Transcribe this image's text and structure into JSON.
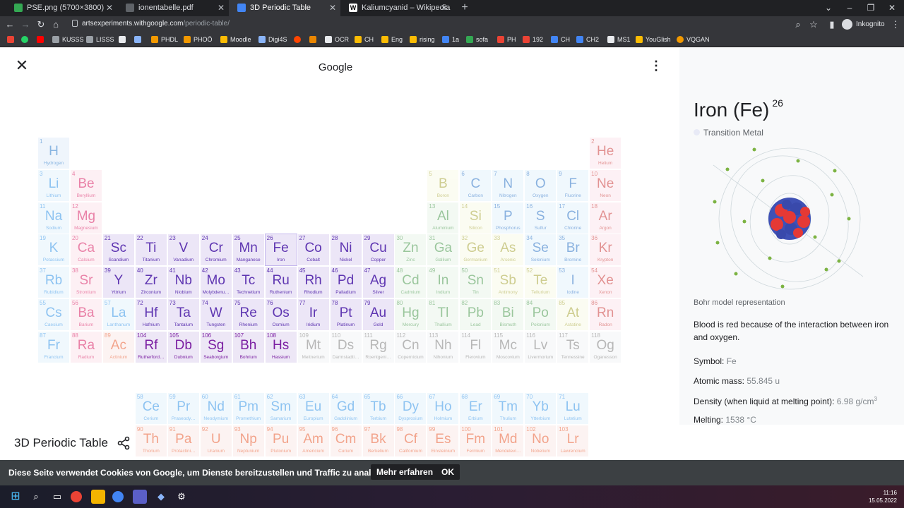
{
  "browser": {
    "tabs": [
      {
        "title": "PSE.png (5700×3800)",
        "icon": "image-icon",
        "color": "#34a853"
      },
      {
        "title": "ionentabelle.pdf",
        "icon": "pdf-icon",
        "color": "#5f6368"
      },
      {
        "title": "3D Periodic Table",
        "icon": "ae-icon",
        "color": "#4285f4"
      },
      {
        "title": "Kaliumcyanid – Wikipedia",
        "icon": "wikipedia-icon",
        "color": "#ffffff"
      }
    ],
    "new_tab": "+",
    "url_domain": "artsexperiments.withgoogle.com",
    "url_path": "/periodic-table/",
    "profile": "Inkognito",
    "bookmarks": [
      "",
      "",
      "",
      "KUSSS",
      "LISSS",
      "",
      "",
      "PHDL",
      "PHOÖ",
      "Moodle",
      "Digi4S",
      "",
      "",
      "OCR",
      "CH",
      "Eng",
      "rising",
      "1a",
      "sofa",
      "PH",
      "192",
      "CH",
      "CH2",
      "MS1",
      "YouGlish",
      "VQGAN"
    ]
  },
  "header": {
    "title": "Google",
    "close_icon": "close-icon",
    "menu_icon": "more-vert-icon"
  },
  "element_panel": {
    "name": "Iron (Fe)",
    "number": "26",
    "category": "Transition Metal",
    "bohr_caption": "Bohr model representation",
    "fact": "Blood is red because of the interaction between iron and oxygen.",
    "properties": [
      {
        "label": "Symbol:",
        "value": "Fe",
        "sup": ""
      },
      {
        "label": "Atomic mass:",
        "value": "55.845 u",
        "sup": ""
      },
      {
        "label": "Density (when liquid at melting point):",
        "value": "6.98 g/cm",
        "sup": "3"
      },
      {
        "label": "Melting:",
        "value": "1538 °C",
        "sup": ""
      }
    ]
  },
  "footer": {
    "title": "3D Periodic Table",
    "share_icon": "share-icon"
  },
  "cookie": {
    "text": "Diese Seite verwendet Cookies von Google, um Dienste bereitzustellen und Traffic zu analysieren.",
    "more": "Mehr erfahren",
    "ok": "OK"
  },
  "taskbar": {
    "time": "11:16",
    "date": "15.05.2022"
  },
  "colors": {
    "H": "#2979c9",
    "M": "#d81b60",
    "E": "#7b1fa2",
    "T": "#5e35b1",
    "L": "#1e88e5",
    "A": "#e64a19",
    "P": "#388e3c",
    "Q": "#9e9d24",
    "N": "#1565c0",
    "G": "#c62828",
    "Z": "#616161"
  },
  "elements": [
    [
      "1",
      "H",
      "Hydrogen",
      "H",
      1,
      1
    ],
    [
      "2",
      "He",
      "Helium",
      "G",
      1,
      18
    ],
    [
      "3",
      "Li",
      "Lithium",
      "L",
      2,
      1
    ],
    [
      "4",
      "Be",
      "Beryllium",
      "M",
      2,
      2
    ],
    [
      "5",
      "B",
      "Boron",
      "Q",
      2,
      13
    ],
    [
      "6",
      "C",
      "Carbon",
      "N",
      2,
      14
    ],
    [
      "7",
      "N",
      "Nitrogen",
      "N",
      2,
      15
    ],
    [
      "8",
      "O",
      "Oxygen",
      "N",
      2,
      16
    ],
    [
      "9",
      "F",
      "Fluorine",
      "N",
      2,
      17
    ],
    [
      "10",
      "Ne",
      "Neon",
      "G",
      2,
      18
    ],
    [
      "11",
      "Na",
      "Sodium",
      "L",
      3,
      1
    ],
    [
      "12",
      "Mg",
      "Magnesium",
      "M",
      3,
      2
    ],
    [
      "13",
      "Al",
      "Aluminium",
      "P",
      3,
      13
    ],
    [
      "14",
      "Si",
      "Silicon",
      "Q",
      3,
      14
    ],
    [
      "15",
      "P",
      "Phosphorus",
      "N",
      3,
      15
    ],
    [
      "16",
      "S",
      "Sulfur",
      "N",
      3,
      16
    ],
    [
      "17",
      "Cl",
      "Chlorine",
      "N",
      3,
      17
    ],
    [
      "18",
      "Ar",
      "Argon",
      "G",
      3,
      18
    ],
    [
      "19",
      "K",
      "Potassium",
      "L",
      4,
      1
    ],
    [
      "20",
      "Ca",
      "Calcium",
      "M",
      4,
      2
    ],
    [
      "21",
      "Sc",
      "Scandium",
      "T",
      4,
      3
    ],
    [
      "22",
      "Ti",
      "Titanium",
      "T",
      4,
      4
    ],
    [
      "23",
      "V",
      "Vanadium",
      "T",
      4,
      5
    ],
    [
      "24",
      "Cr",
      "Chromium",
      "T",
      4,
      6
    ],
    [
      "25",
      "Mn",
      "Manganese",
      "T",
      4,
      7
    ],
    [
      "26",
      "Fe",
      "Iron",
      "T",
      4,
      8
    ],
    [
      "27",
      "Co",
      "Cobalt",
      "T",
      4,
      9
    ],
    [
      "28",
      "Ni",
      "Nickel",
      "T",
      4,
      10
    ],
    [
      "29",
      "Cu",
      "Copper",
      "T",
      4,
      11
    ],
    [
      "30",
      "Zn",
      "Zinc",
      "P",
      4,
      12
    ],
    [
      "31",
      "Ga",
      "Gallium",
      "P",
      4,
      13
    ],
    [
      "32",
      "Ge",
      "Germanium",
      "Q",
      4,
      14
    ],
    [
      "33",
      "As",
      "Arsenic",
      "Q",
      4,
      15
    ],
    [
      "34",
      "Se",
      "Selenium",
      "N",
      4,
      16
    ],
    [
      "35",
      "Br",
      "Bromine",
      "N",
      4,
      17
    ],
    [
      "36",
      "Kr",
      "Krypton",
      "G",
      4,
      18
    ],
    [
      "37",
      "Rb",
      "Rubidium",
      "L",
      5,
      1
    ],
    [
      "38",
      "Sr",
      "Strontium",
      "M",
      5,
      2
    ],
    [
      "39",
      "Y",
      "Yttrium",
      "T",
      5,
      3
    ],
    [
      "40",
      "Zr",
      "Zirconium",
      "T",
      5,
      4
    ],
    [
      "41",
      "Nb",
      "Niobium",
      "T",
      5,
      5
    ],
    [
      "42",
      "Mo",
      "Molybdenu…",
      "T",
      5,
      6
    ],
    [
      "43",
      "Tc",
      "Technetium",
      "T",
      5,
      7
    ],
    [
      "44",
      "Ru",
      "Ruthenium",
      "T",
      5,
      8
    ],
    [
      "45",
      "Rh",
      "Rhodium",
      "T",
      5,
      9
    ],
    [
      "46",
      "Pd",
      "Palladium",
      "T",
      5,
      10
    ],
    [
      "47",
      "Ag",
      "Silver",
      "T",
      5,
      11
    ],
    [
      "48",
      "Cd",
      "Cadmium",
      "P",
      5,
      12
    ],
    [
      "49",
      "In",
      "Indium",
      "P",
      5,
      13
    ],
    [
      "50",
      "Sn",
      "Tin",
      "P",
      5,
      14
    ],
    [
      "51",
      "Sb",
      "Antimony",
      "Q",
      5,
      15
    ],
    [
      "52",
      "Te",
      "Tellurium",
      "Q",
      5,
      16
    ],
    [
      "53",
      "I",
      "Iodine",
      "N",
      5,
      17
    ],
    [
      "54",
      "Xe",
      "Xenon",
      "G",
      5,
      18
    ],
    [
      "55",
      "Cs",
      "Caesium",
      "L",
      6,
      1
    ],
    [
      "56",
      "Ba",
      "Barium",
      "M",
      6,
      2
    ],
    [
      "57",
      "La",
      "Lanthanum",
      "L",
      6,
      3
    ],
    [
      "72",
      "Hf",
      "Hafnium",
      "T",
      6,
      4
    ],
    [
      "73",
      "Ta",
      "Tantalum",
      "T",
      6,
      5
    ],
    [
      "74",
      "W",
      "Tungsten",
      "T",
      6,
      6
    ],
    [
      "75",
      "Re",
      "Rhenium",
      "T",
      6,
      7
    ],
    [
      "76",
      "Os",
      "Osmium",
      "T",
      6,
      8
    ],
    [
      "77",
      "Ir",
      "Iridium",
      "T",
      6,
      9
    ],
    [
      "78",
      "Pt",
      "Platinum",
      "T",
      6,
      10
    ],
    [
      "79",
      "Au",
      "Gold",
      "T",
      6,
      11
    ],
    [
      "80",
      "Hg",
      "Mercury",
      "P",
      6,
      12
    ],
    [
      "81",
      "Tl",
      "Thallium",
      "P",
      6,
      13
    ],
    [
      "82",
      "Pb",
      "Lead",
      "P",
      6,
      14
    ],
    [
      "83",
      "Bi",
      "Bismuth",
      "P",
      6,
      15
    ],
    [
      "84",
      "Po",
      "Polonium",
      "P",
      6,
      16
    ],
    [
      "85",
      "At",
      "Astatine",
      "Q",
      6,
      17
    ],
    [
      "86",
      "Rn",
      "Radon",
      "G",
      6,
      18
    ],
    [
      "87",
      "Fr",
      "Francium",
      "L",
      7,
      1
    ],
    [
      "88",
      "Ra",
      "Radium",
      "M",
      7,
      2
    ],
    [
      "89",
      "Ac",
      "Actinium",
      "A",
      7,
      3
    ],
    [
      "104",
      "Rf",
      "Rutherford…",
      "E",
      7,
      4
    ],
    [
      "105",
      "Db",
      "Dubnium",
      "E",
      7,
      5
    ],
    [
      "106",
      "Sg",
      "Seaborgium",
      "E",
      7,
      6
    ],
    [
      "107",
      "Bh",
      "Bohrium",
      "E",
      7,
      7
    ],
    [
      "108",
      "Hs",
      "Hassium",
      "E",
      7,
      8
    ],
    [
      "109",
      "Mt",
      "Meitnerium",
      "Z",
      7,
      9
    ],
    [
      "110",
      "Ds",
      "Darmstadti…",
      "Z",
      7,
      10
    ],
    [
      "111",
      "Rg",
      "Roentgeni…",
      "Z",
      7,
      11
    ],
    [
      "112",
      "Cn",
      "Copernicium",
      "Z",
      7,
      12
    ],
    [
      "113",
      "Nh",
      "Nihonium",
      "Z",
      7,
      13
    ],
    [
      "114",
      "Fl",
      "Flerovium",
      "Z",
      7,
      14
    ],
    [
      "115",
      "Mc",
      "Moscovium",
      "Z",
      7,
      15
    ],
    [
      "116",
      "Lv",
      "Livermorium",
      "Z",
      7,
      16
    ],
    [
      "117",
      "Ts",
      "Tennessine",
      "Z",
      7,
      17
    ],
    [
      "118",
      "Og",
      "Oganesson",
      "Z",
      7,
      18
    ],
    [
      "58",
      "Ce",
      "Cerium",
      "L",
      9,
      4
    ],
    [
      "59",
      "Pr",
      "Praseody…",
      "L",
      9,
      5
    ],
    [
      "60",
      "Nd",
      "Neodymium",
      "L",
      9,
      6
    ],
    [
      "61",
      "Pm",
      "Promethium",
      "L",
      9,
      7
    ],
    [
      "62",
      "Sm",
      "Samarium",
      "L",
      9,
      8
    ],
    [
      "63",
      "Eu",
      "Europium",
      "L",
      9,
      9
    ],
    [
      "64",
      "Gd",
      "Gadolinium",
      "L",
      9,
      10
    ],
    [
      "65",
      "Tb",
      "Terbium",
      "L",
      9,
      11
    ],
    [
      "66",
      "Dy",
      "Dysprosium",
      "L",
      9,
      12
    ],
    [
      "67",
      "Ho",
      "Holmium",
      "L",
      9,
      13
    ],
    [
      "68",
      "Er",
      "Erbium",
      "L",
      9,
      14
    ],
    [
      "69",
      "Tm",
      "Thulium",
      "L",
      9,
      15
    ],
    [
      "70",
      "Yb",
      "Ytterbium",
      "L",
      9,
      16
    ],
    [
      "71",
      "Lu",
      "Lutetium",
      "L",
      9,
      17
    ],
    [
      "90",
      "Th",
      "Thorium",
      "A",
      10,
      4
    ],
    [
      "91",
      "Pa",
      "Protactini…",
      "A",
      10,
      5
    ],
    [
      "92",
      "U",
      "Uranium",
      "A",
      10,
      6
    ],
    [
      "93",
      "Np",
      "Neptunium",
      "A",
      10,
      7
    ],
    [
      "94",
      "Pu",
      "Plutonium",
      "A",
      10,
      8
    ],
    [
      "95",
      "Am",
      "Americium",
      "A",
      10,
      9
    ],
    [
      "96",
      "Cm",
      "Curium",
      "A",
      10,
      10
    ],
    [
      "97",
      "Bk",
      "Berkelium",
      "A",
      10,
      11
    ],
    [
      "98",
      "Cf",
      "Californium",
      "A",
      10,
      12
    ],
    [
      "99",
      "Es",
      "Einsteinium",
      "A",
      10,
      13
    ],
    [
      "100",
      "Fm",
      "Fermium",
      "A",
      10,
      14
    ],
    [
      "101",
      "Md",
      "Mendelevi…",
      "A",
      10,
      15
    ],
    [
      "102",
      "No",
      "Nobelium",
      "A",
      10,
      16
    ],
    [
      "103",
      "Lr",
      "Lawrencium",
      "A",
      10,
      17
    ]
  ]
}
